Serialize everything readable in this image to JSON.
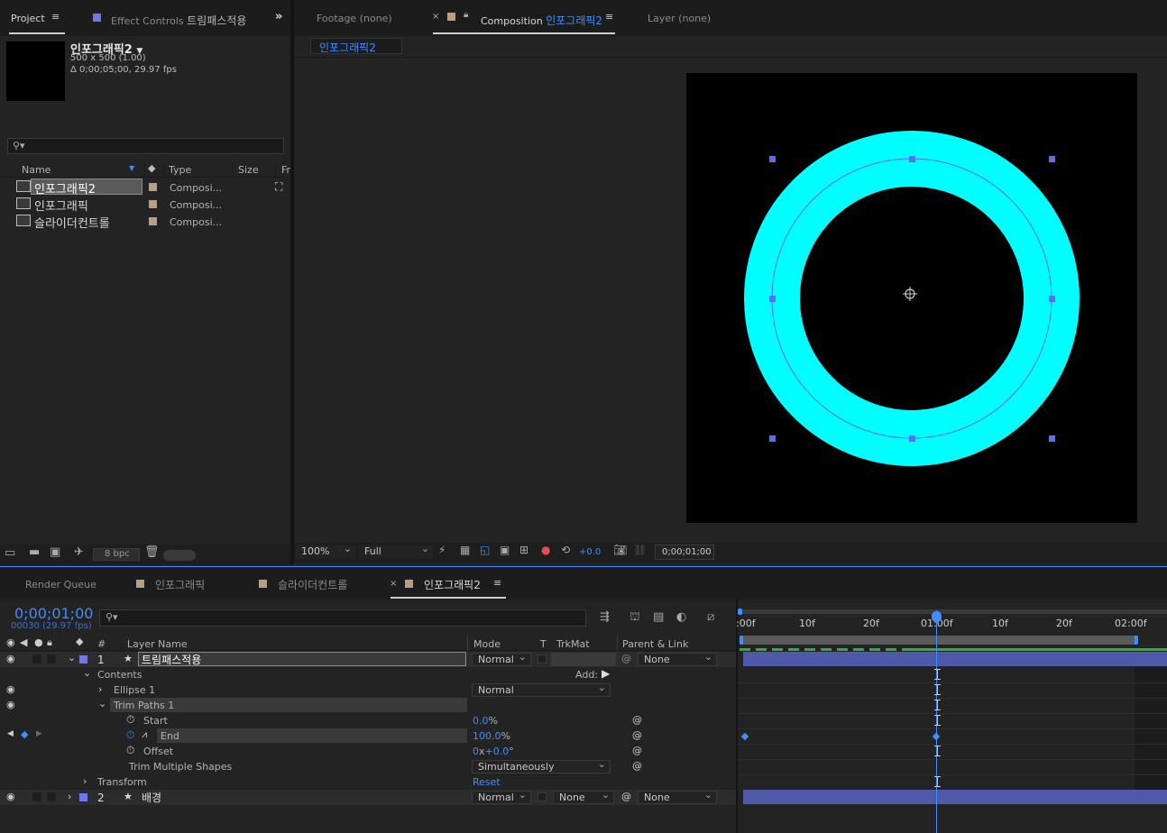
{
  "project_panel": {
    "tab_project": "Project",
    "tab_effect_prefix": "Effect Controls",
    "tab_effect_layer": "트림패스적용",
    "comp_name": "인포그래픽2",
    "comp_size": "500 x 500 (1.00)",
    "comp_duration": "Δ 0;00;05;00, 29.97 fps",
    "search_placeholder": "",
    "col_name": "Name",
    "col_type": "Type",
    "col_size": "Size",
    "col_fr": "Fr",
    "items": [
      {
        "name": "인포그래픽2",
        "type": "Composi..."
      },
      {
        "name": "인포그래픽",
        "type": "Composi..."
      },
      {
        "name": "슬라이더컨트롤",
        "type": "Composi..."
      }
    ],
    "bpc": "8 bpc"
  },
  "viewer": {
    "tab_footage": "Footage  (none)",
    "tab_composition": "Composition",
    "tab_composition_name": "인포그래픽2",
    "tab_layer": "Layer  (none)",
    "breadcrumb": "인포그래픽2",
    "zoom": "100%",
    "resolution": "Full",
    "exposure": "+0.0",
    "timecode": "0;00;01;00"
  },
  "timeline": {
    "tab_render_queue": "Render Queue",
    "tab_comp1": "인포그래픽",
    "tab_comp2": "슬라이더컨트롤",
    "tab_comp3": "인포그래픽2",
    "current_time": "0;00;01;00",
    "frame_info": "00030 (29.97 fps)",
    "col_num": "#",
    "col_layer_name": "Layer Name",
    "col_mode": "Mode",
    "col_t": "T",
    "col_trkmat": "TrkMat",
    "col_parent": "Parent & Link",
    "ruler": [
      ":00f",
      "10f",
      "20f",
      "01:00f",
      "10f",
      "20f",
      "02:00f"
    ],
    "layers": [
      {
        "num": "1",
        "name": "트림패스적용",
        "mode": "Normal",
        "parent": "None"
      },
      {
        "num": "2",
        "name": "배경",
        "mode": "Normal",
        "trkmat": "None",
        "parent": "None"
      }
    ],
    "props": {
      "contents": "Contents",
      "add": "Add:",
      "ellipse": "Ellipse 1",
      "ellipse_mode": "Normal",
      "trim": "Trim Paths 1",
      "start": "Start",
      "start_val": "0.0",
      "end": "End",
      "end_val": "100.0",
      "offset": "Offset",
      "offset_rev": "0",
      "offset_deg": "+0.0",
      "trim_multiple": "Trim Multiple Shapes",
      "trim_multiple_val": "Simultaneously",
      "transform": "Transform",
      "reset": "Reset"
    },
    "units": {
      "percent": "%",
      "x": "x",
      "degree": "°"
    }
  },
  "colors": {
    "accent": "#3f8dff",
    "ring": "#00ffff",
    "layer_label": "#6e78e8",
    "tan": "#b79f80",
    "layer_bar": "#4e5aa8"
  }
}
